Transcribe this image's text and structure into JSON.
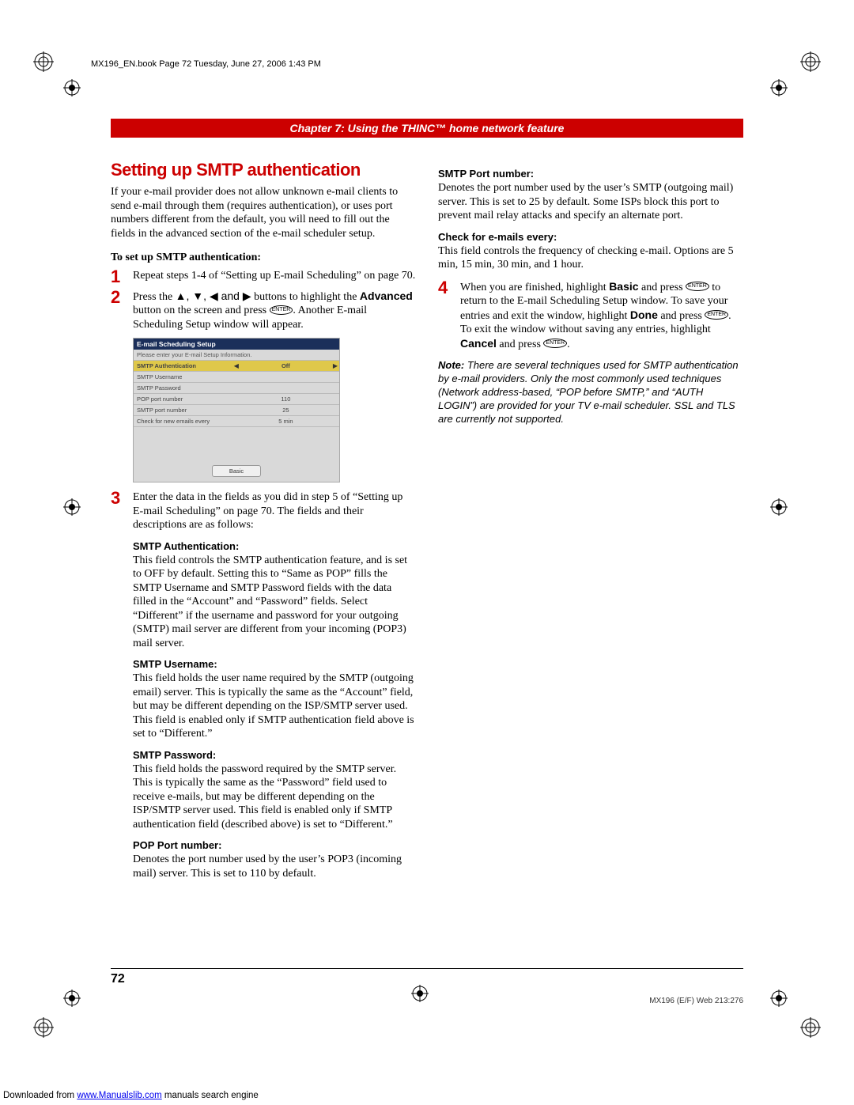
{
  "header_line": "MX196_EN.book  Page 72  Tuesday, June 27, 2006  1:43 PM",
  "chapter_bar": "Chapter 7: Using the THINC™ home network feature",
  "section_title": "Setting up SMTP authentication",
  "intro": "If your e-mail provider does not allow unknown e-mail clients to send e-mail through them (requires authentication), or uses port numbers different from the default, you will need to fill out the fields in the advanced section of the e-mail scheduler setup.",
  "subhead": "To set up SMTP authentication:",
  "steps": {
    "s1": "Repeat steps 1-4 of “Setting up E-mail Scheduling” on page 70.",
    "s2_a": "Press the ",
    "s2_arrows": "▲, ▼, ◀ and ▶",
    "s2_b": " buttons to highlight the ",
    "s2_advanced": "Advanced",
    "s2_c": " button on the screen and press ",
    "s2_enter": "ENTER",
    "s2_d": ". Another E-mail Scheduling Setup window will appear.",
    "s3": "Enter the data in the fields as you did in step 5 of “Setting up E-mail Scheduling” on page 70. The fields and their descriptions are as follows:",
    "s4_a": "When you are finished, highlight ",
    "s4_basic": "Basic",
    "s4_b": " and press ",
    "s4_c": " to return to the E-mail Scheduling Setup window. To save your entries and exit the window, highlight ",
    "s4_done": "Done",
    "s4_d": " and press ",
    "s4_e": ". To exit the window without saving any entries, highlight ",
    "s4_cancel": "Cancel",
    "s4_f": " and press ",
    "s4_g": "."
  },
  "osd": {
    "title": "E-mail Scheduling Setup",
    "prompt": "Please enter your E-mail Setup Information.",
    "rows": [
      {
        "label": "SMTP Authentication",
        "value": "Off",
        "hl": true
      },
      {
        "label": "SMTP Username",
        "value": ""
      },
      {
        "label": "SMTP Password",
        "value": ""
      },
      {
        "label": "POP port number",
        "value": "110"
      },
      {
        "label": "SMTP port number",
        "value": "25"
      },
      {
        "label": "Check for new emails every",
        "value": "5 min"
      }
    ],
    "basic_btn": "Basic"
  },
  "fields": {
    "f1_h": "SMTP Authentication:",
    "f1_b": "This field controls the SMTP authentication feature, and is set to OFF by default. Setting this to “Same as POP” fills the SMTP Username and SMTP Password fields with the data filled in the “Account” and “Password” fields. Select “Different” if the username and password for your outgoing (SMTP) mail server are different from your incoming (POP3) mail server.",
    "f2_h": "SMTP Username:",
    "f2_b": "This field holds the user name required by the SMTP (outgoing email) server. This is typically the same as the “Account” field, but may be different depending on the ISP/SMTP server used. This field is enabled only if SMTP authentication field above is set to “Different.”",
    "f3_h": "SMTP Password:",
    "f3_b": "This field holds the password required by the SMTP server. This is typically the same as the “Password” field used to receive e-mails, but may be different depending on the ISP/SMTP server used. This field is enabled only if SMTP authentication field (described above) is set to “Different.”",
    "f4_h": "POP Port number:",
    "f4_b": "Denotes the port number used by the user’s POP3 (incoming mail) server. This is set to 110 by default.",
    "f5_h": "SMTP Port number:",
    "f5_b": "Denotes the port number used by the user’s SMTP (outgoing mail) server. This is set to 25 by default. Some ISPs block this port to prevent mail relay attacks and specify an alternate port.",
    "f6_h": "Check for e-mails every:",
    "f6_b": "This field controls the frequency of checking e-mail. Options are 5 min, 15 min, 30 min, and 1 hour."
  },
  "note_label": "Note:",
  "note_body": " There are several techniques used for SMTP authentication by e-mail providers. Only the most commonly used techniques (Network address-based, “POP before SMTP,” and “AUTH LOGIN”) are provided for your TV e-mail scheduler. SSL and TLS are currently not supported.",
  "page_number": "72",
  "footer_right": "MX196 (E/F) Web 213:276",
  "download_prefix": "Downloaded from ",
  "download_link": "www.Manualslib.com",
  "download_suffix": " manuals search engine"
}
